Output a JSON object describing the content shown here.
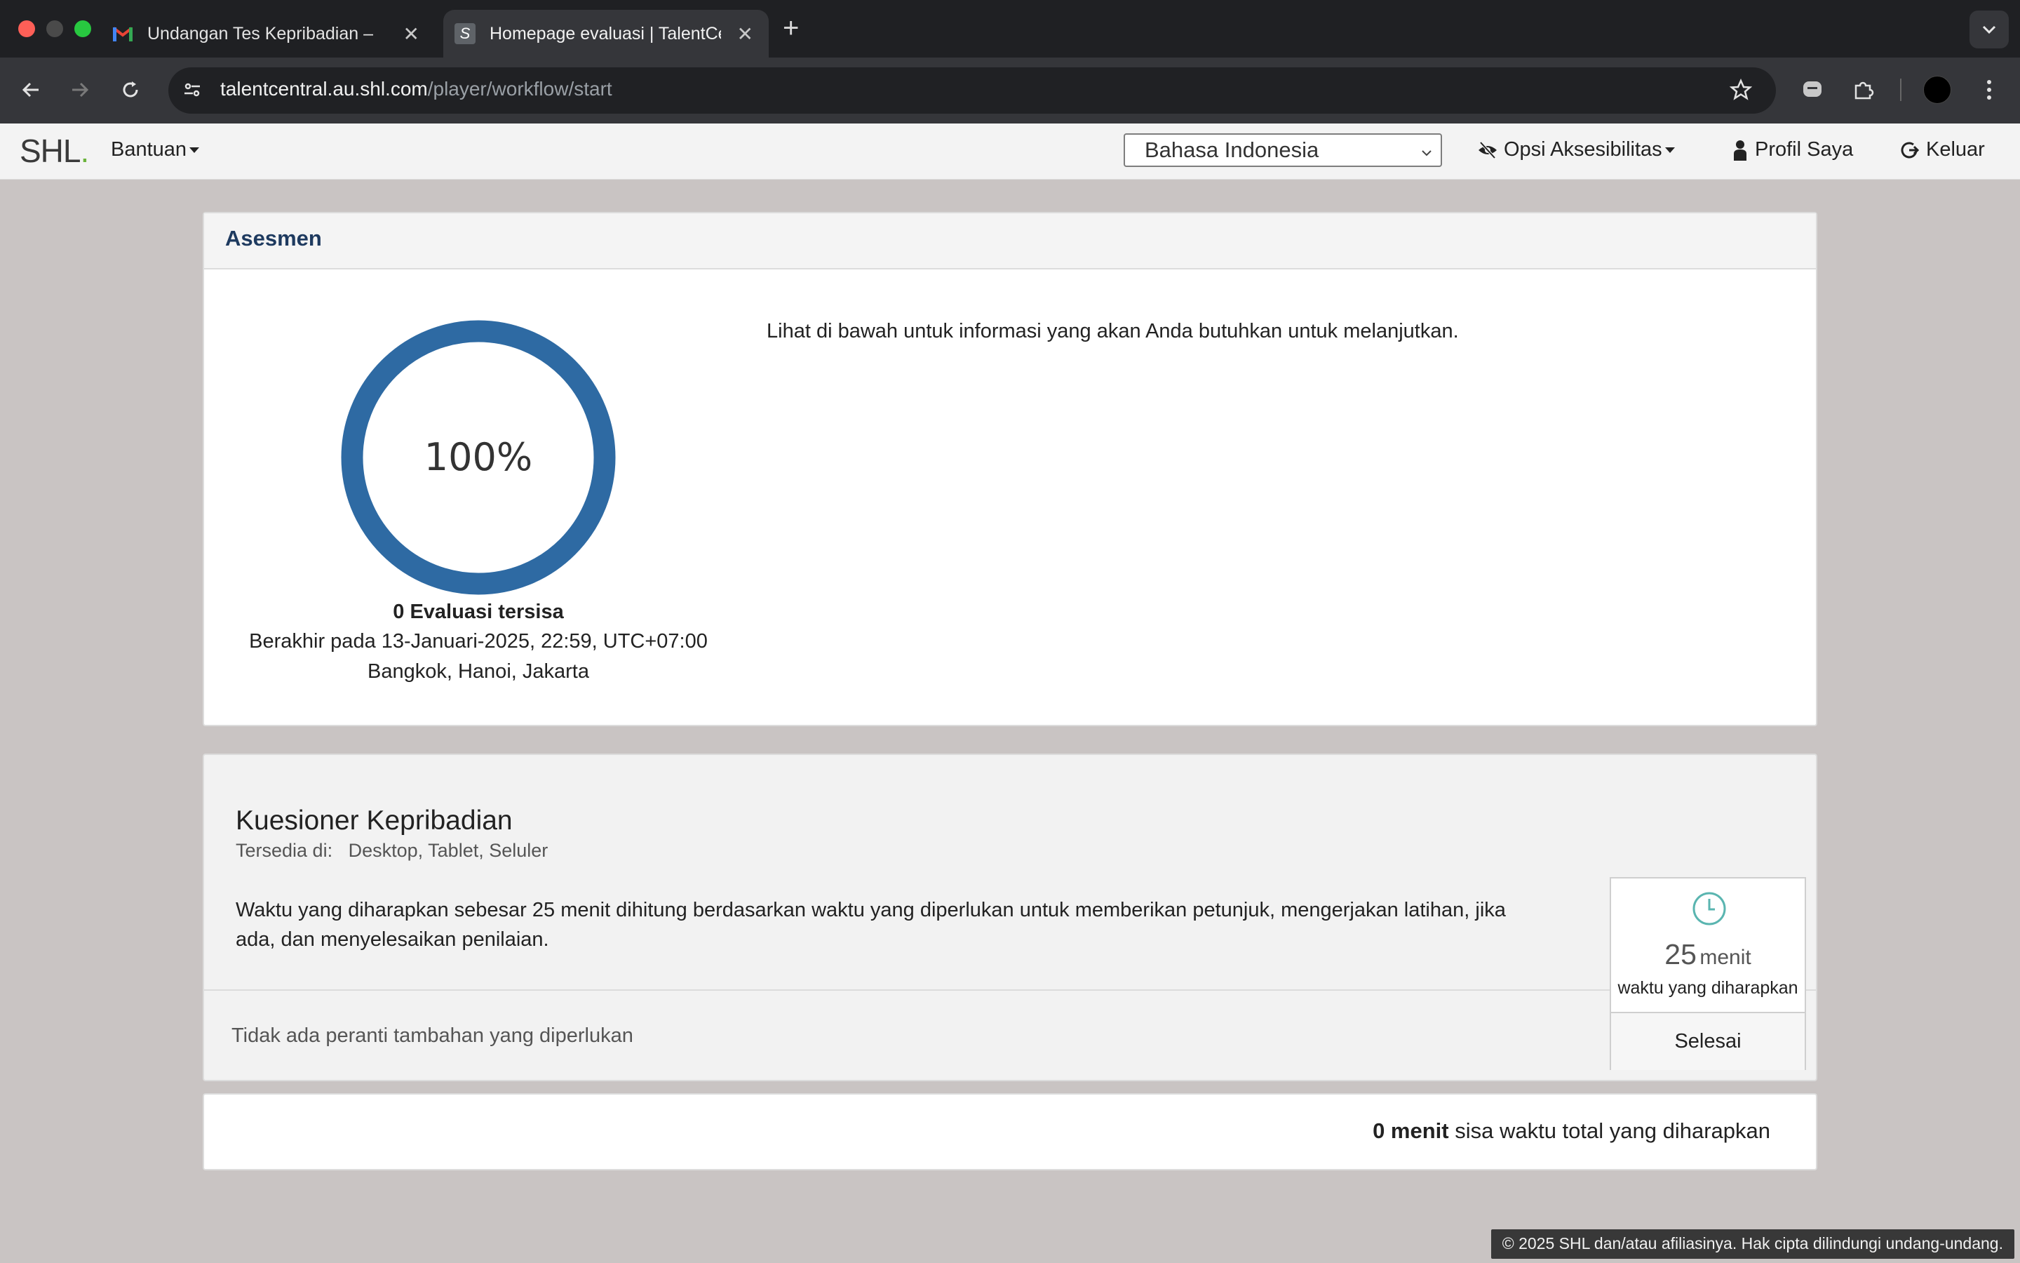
{
  "browser": {
    "tabs": [
      {
        "title": "Undangan Tes Kepribadian – I",
        "favicon": "gmail-icon",
        "active": false
      },
      {
        "title": "Homepage evaluasi | TalentCe",
        "favicon": "shl-icon",
        "active": true
      }
    ],
    "url_host": "talentcentral.au.shl.com",
    "url_path": "/player/workflow/start"
  },
  "header": {
    "logo": "SHL",
    "help_label": "Bantuan",
    "language": "Bahasa Indonesia",
    "accessibility_label": "Opsi Aksesibilitas",
    "profile_label": "Profil Saya",
    "logout_label": "Keluar"
  },
  "assessment": {
    "heading": "Asesmen",
    "progress_percent": 100,
    "progress_text": "100%",
    "remaining": "0 Evaluasi tersisa",
    "deadline_line1": "Berakhir pada 13-Januari-2025, 22:59, UTC+07:00",
    "deadline_line2": "Bangkok, Hanoi, Jakarta",
    "info": "Lihat di bawah untuk informasi yang akan Anda butuhkan untuk melanjutkan."
  },
  "questionnaire": {
    "title": "Kuesioner Kepribadian",
    "available_label": "Tersedia di:",
    "available_devices": "Desktop, Tablet, Seluler",
    "description": "Waktu yang diharapkan sebesar 25 menit dihitung berdasarkan waktu yang diperlukan untuk memberikan petunjuk, mengerjakan latihan, jika ada, dan menyelesaikan penilaian.",
    "tools": "Tidak ada peranti tambahan yang diperlukan",
    "time_value": "25",
    "time_unit": "menit",
    "time_label": "waktu yang diharapkan",
    "status": "Selesai"
  },
  "summary": {
    "total_time": "0 menit",
    "total_label": "sisa waktu total yang diharapkan"
  },
  "footer": {
    "copyright": "© 2025 SHL dan/atau afiliasinya. Hak cipta dilindungi undang-undang."
  },
  "colors": {
    "progress_ring": "#2e6aa3",
    "heading_blue": "#1e3a5f",
    "page_bg": "#c9c4c3",
    "clock": "#5ab5b0"
  }
}
